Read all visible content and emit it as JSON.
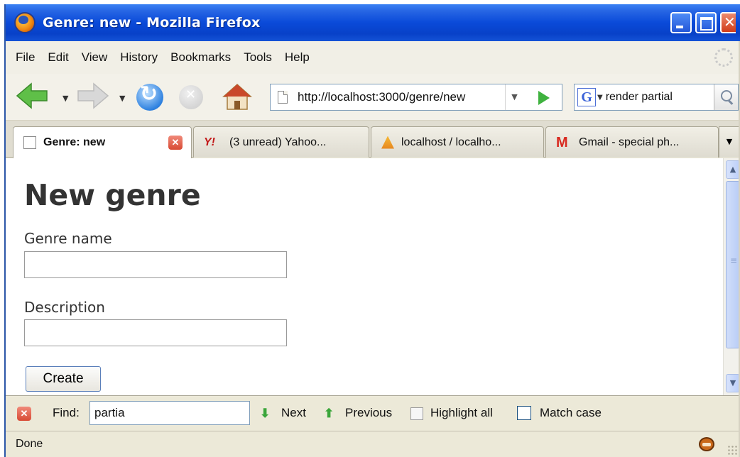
{
  "window": {
    "title": "Genre: new - Mozilla Firefox"
  },
  "menubar": {
    "items": [
      "File",
      "Edit",
      "View",
      "History",
      "Bookmarks",
      "Tools",
      "Help"
    ]
  },
  "navbar": {
    "url": "http://localhost:3000/genre/new",
    "search_value": "render partial",
    "search_engine_icon": "google-icon"
  },
  "tabs": [
    {
      "label": "Genre: new",
      "icon": "page-icon",
      "active": true
    },
    {
      "label": "(3 unread) Yahoo...",
      "icon": "yahoo-icon",
      "active": false
    },
    {
      "label": "localhost / localho...",
      "icon": "phpmyadmin-icon",
      "active": false
    },
    {
      "label": "Gmail - special ph...",
      "icon": "gmail-icon",
      "active": false
    }
  ],
  "page": {
    "heading": "New genre",
    "fields": [
      {
        "label": "Genre name",
        "value": ""
      },
      {
        "label": "Description",
        "value": ""
      }
    ],
    "submit_label": "Create"
  },
  "findbar": {
    "label": "Find:",
    "value": "partia",
    "next_label": "Next",
    "previous_label": "Previous",
    "highlight_label": "Highlight all",
    "match_case_label": "Match case",
    "match_case_checked": false
  },
  "status": {
    "text": "Done"
  },
  "colors": {
    "titlebar": "#0a4ad9",
    "heading": "#333333",
    "find_arrows": "#3aa53a",
    "close_red": "#d84a34"
  }
}
